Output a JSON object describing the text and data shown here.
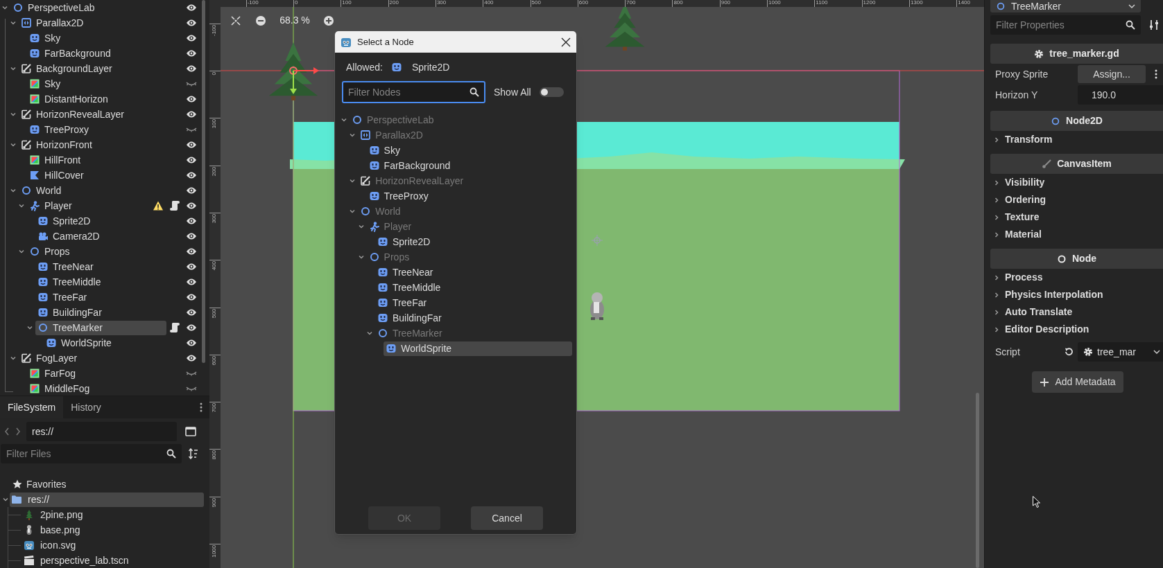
{
  "scene_tree": [
    {
      "name": "PerspectiveLab",
      "kind": "node",
      "visible": true,
      "selected": false,
      "expanded": true,
      "children": [
        {
          "name": "Parallax2D",
          "kind": "parallax",
          "visible": true,
          "selected": false,
          "expanded": true,
          "children": [
            {
              "name": "Sky",
              "kind": "sprite",
              "visible": true,
              "selected": false
            },
            {
              "name": "FarBackground",
              "kind": "sprite",
              "visible": true,
              "selected": false
            }
          ]
        },
        {
          "name": "BackgroundLayer",
          "kind": "layer",
          "visible": true,
          "selected": false,
          "expanded": true,
          "children": [
            {
              "name": "Sky",
              "kind": "texture",
              "visible": false,
              "selected": false
            },
            {
              "name": "DistantHorizon",
              "kind": "texture",
              "visible": true,
              "selected": false
            }
          ]
        },
        {
          "name": "HorizonRevealLayer",
          "kind": "layer",
          "visible": true,
          "selected": false,
          "expanded": true,
          "children": [
            {
              "name": "TreeProxy",
              "kind": "sprite",
              "visible": false,
              "selected": false
            }
          ]
        },
        {
          "name": "HorizonFront",
          "kind": "layer",
          "visible": true,
          "selected": false,
          "expanded": true,
          "children": [
            {
              "name": "HillFront",
              "kind": "texture",
              "visible": true,
              "selected": false
            },
            {
              "name": "HillCover",
              "kind": "polygon",
              "visible": true,
              "selected": false
            }
          ]
        },
        {
          "name": "World",
          "kind": "node",
          "visible": true,
          "selected": false,
          "expanded": true,
          "children": [
            {
              "name": "Player",
              "kind": "body",
              "visible": true,
              "selected": false,
              "warning": true,
              "script": true,
              "expanded": true,
              "children": [
                {
                  "name": "Sprite2D",
                  "kind": "sprite",
                  "visible": true,
                  "selected": false
                },
                {
                  "name": "Camera2D",
                  "kind": "camera",
                  "visible": true,
                  "selected": false
                }
              ]
            },
            {
              "name": "Props",
              "kind": "node",
              "visible": true,
              "selected": false,
              "expanded": true,
              "children": [
                {
                  "name": "TreeNear",
                  "kind": "sprite",
                  "visible": true,
                  "selected": false
                },
                {
                  "name": "TreeMiddle",
                  "kind": "sprite",
                  "visible": true,
                  "selected": false
                },
                {
                  "name": "TreeFar",
                  "kind": "sprite",
                  "visible": true,
                  "selected": false
                },
                {
                  "name": "BuildingFar",
                  "kind": "sprite",
                  "visible": true,
                  "selected": false
                },
                {
                  "name": "TreeMarker",
                  "kind": "node",
                  "visible": true,
                  "selected": true,
                  "script": true,
                  "expanded": true,
                  "children": [
                    {
                      "name": "WorldSprite",
                      "kind": "sprite",
                      "visible": true,
                      "selected": false
                    }
                  ]
                }
              ]
            }
          ]
        },
        {
          "name": "FogLayer",
          "kind": "layer",
          "visible": true,
          "selected": false,
          "expanded": true,
          "children": [
            {
              "name": "FarFog",
              "kind": "texture",
              "visible": false,
              "selected": false
            },
            {
              "name": "MiddleFog",
              "kind": "texture",
              "visible": false,
              "selected": false
            }
          ]
        }
      ]
    }
  ],
  "filesystem": {
    "tabs": [
      {
        "label": "FileSystem",
        "selected": true
      },
      {
        "label": "History",
        "selected": false
      }
    ],
    "path": "res://",
    "filter": {
      "placeholder": "Filter Files"
    },
    "favorites": "Favorites",
    "tree": [
      {
        "name": "res://",
        "kind": "folder",
        "selected": true,
        "expanded": true,
        "children": [
          {
            "name": "2pine.png",
            "kind": "tree-image",
            "selected": false
          },
          {
            "name": "base.png",
            "kind": "figure-image",
            "selected": false
          },
          {
            "name": "icon.svg",
            "kind": "logo",
            "selected": false
          },
          {
            "name": "perspective_lab.tscn",
            "kind": "scene",
            "selected": false
          }
        ]
      }
    ]
  },
  "viewport": {
    "zoom": "68.3 %",
    "top_ruler": [
      "-100",
      "0",
      "100",
      "200",
      "300",
      "400",
      "500",
      "600",
      "700",
      "800",
      "900",
      "1000",
      "1100",
      "1200",
      "1300",
      "1400"
    ],
    "left_ruler": [
      "-100",
      "0",
      "100",
      "200",
      "300",
      "400",
      "500",
      "600",
      "700",
      "800",
      "900",
      "1000"
    ]
  },
  "dialog": {
    "title": "Select a Node",
    "allowed_label": "Allowed:",
    "allowed_type": "Sprite2D",
    "filter": {
      "placeholder": "Filter Nodes"
    },
    "show_all": {
      "label": "Show All",
      "on": false
    },
    "tree": [
      {
        "name": "PerspectiveLab",
        "kind": "node",
        "disabled": true,
        "selected": false,
        "expanded": true,
        "children": [
          {
            "name": "Parallax2D",
            "kind": "parallax",
            "disabled": true,
            "selected": false,
            "expanded": true,
            "children": [
              {
                "name": "Sky",
                "kind": "sprite",
                "disabled": false,
                "selected": false
              },
              {
                "name": "FarBackground",
                "kind": "sprite",
                "disabled": false,
                "selected": false
              }
            ]
          },
          {
            "name": "HorizonRevealLayer",
            "kind": "layer",
            "disabled": true,
            "selected": false,
            "expanded": true,
            "children": [
              {
                "name": "TreeProxy",
                "kind": "sprite",
                "disabled": false,
                "selected": false
              }
            ]
          },
          {
            "name": "World",
            "kind": "node",
            "disabled": true,
            "selected": false,
            "expanded": true,
            "children": [
              {
                "name": "Player",
                "kind": "body",
                "disabled": true,
                "selected": false,
                "expanded": true,
                "children": [
                  {
                    "name": "Sprite2D",
                    "kind": "sprite",
                    "disabled": false,
                    "selected": false
                  }
                ]
              },
              {
                "name": "Props",
                "kind": "node",
                "disabled": true,
                "selected": false,
                "expanded": true,
                "children": [
                  {
                    "name": "TreeNear",
                    "kind": "sprite",
                    "disabled": false,
                    "selected": false
                  },
                  {
                    "name": "TreeMiddle",
                    "kind": "sprite",
                    "disabled": false,
                    "selected": false
                  },
                  {
                    "name": "TreeFar",
                    "kind": "sprite",
                    "disabled": false,
                    "selected": false
                  },
                  {
                    "name": "BuildingFar",
                    "kind": "sprite",
                    "disabled": false,
                    "selected": false
                  },
                  {
                    "name": "TreeMarker",
                    "kind": "node",
                    "disabled": true,
                    "selected": false,
                    "expanded": true,
                    "children": [
                      {
                        "name": "WorldSprite",
                        "kind": "sprite",
                        "disabled": false,
                        "selected": true
                      }
                    ]
                  }
                ]
              }
            ]
          }
        ]
      }
    ],
    "buttons": [
      {
        "label": "OK",
        "disabled": true
      },
      {
        "label": "Cancel",
        "disabled": false
      }
    ]
  },
  "inspector": {
    "node_selector": "TreeMarker",
    "filter": {
      "placeholder": "Filter Properties"
    },
    "rows": [
      {
        "kind": "script-header",
        "label": "tree_marker.gd"
      },
      {
        "kind": "resource",
        "label": "Proxy Sprite",
        "value": "Assign..."
      },
      {
        "kind": "number",
        "label": "Horizon Y",
        "value": "190.0"
      },
      {
        "kind": "node2d-header",
        "label": "Node2D"
      },
      {
        "kind": "group",
        "label": "Transform",
        "expanded": false
      },
      {
        "kind": "canvasitem-header",
        "label": "CanvasItem"
      },
      {
        "kind": "group",
        "label": "Visibility",
        "expanded": false
      },
      {
        "kind": "group",
        "label": "Ordering",
        "expanded": false
      },
      {
        "kind": "group",
        "label": "Texture",
        "expanded": false
      },
      {
        "kind": "group",
        "label": "Material",
        "expanded": false
      },
      {
        "kind": "node-header",
        "label": "Node"
      },
      {
        "kind": "group",
        "label": "Process",
        "expanded": false
      },
      {
        "kind": "group",
        "label": "Physics Interpolation",
        "expanded": false
      },
      {
        "kind": "group",
        "label": "Auto Translate",
        "expanded": false
      },
      {
        "kind": "group",
        "label": "Editor Description",
        "expanded": false
      },
      {
        "kind": "script",
        "label": "Script",
        "value": "tree_mar"
      }
    ],
    "add_button": "Add Metadata"
  }
}
